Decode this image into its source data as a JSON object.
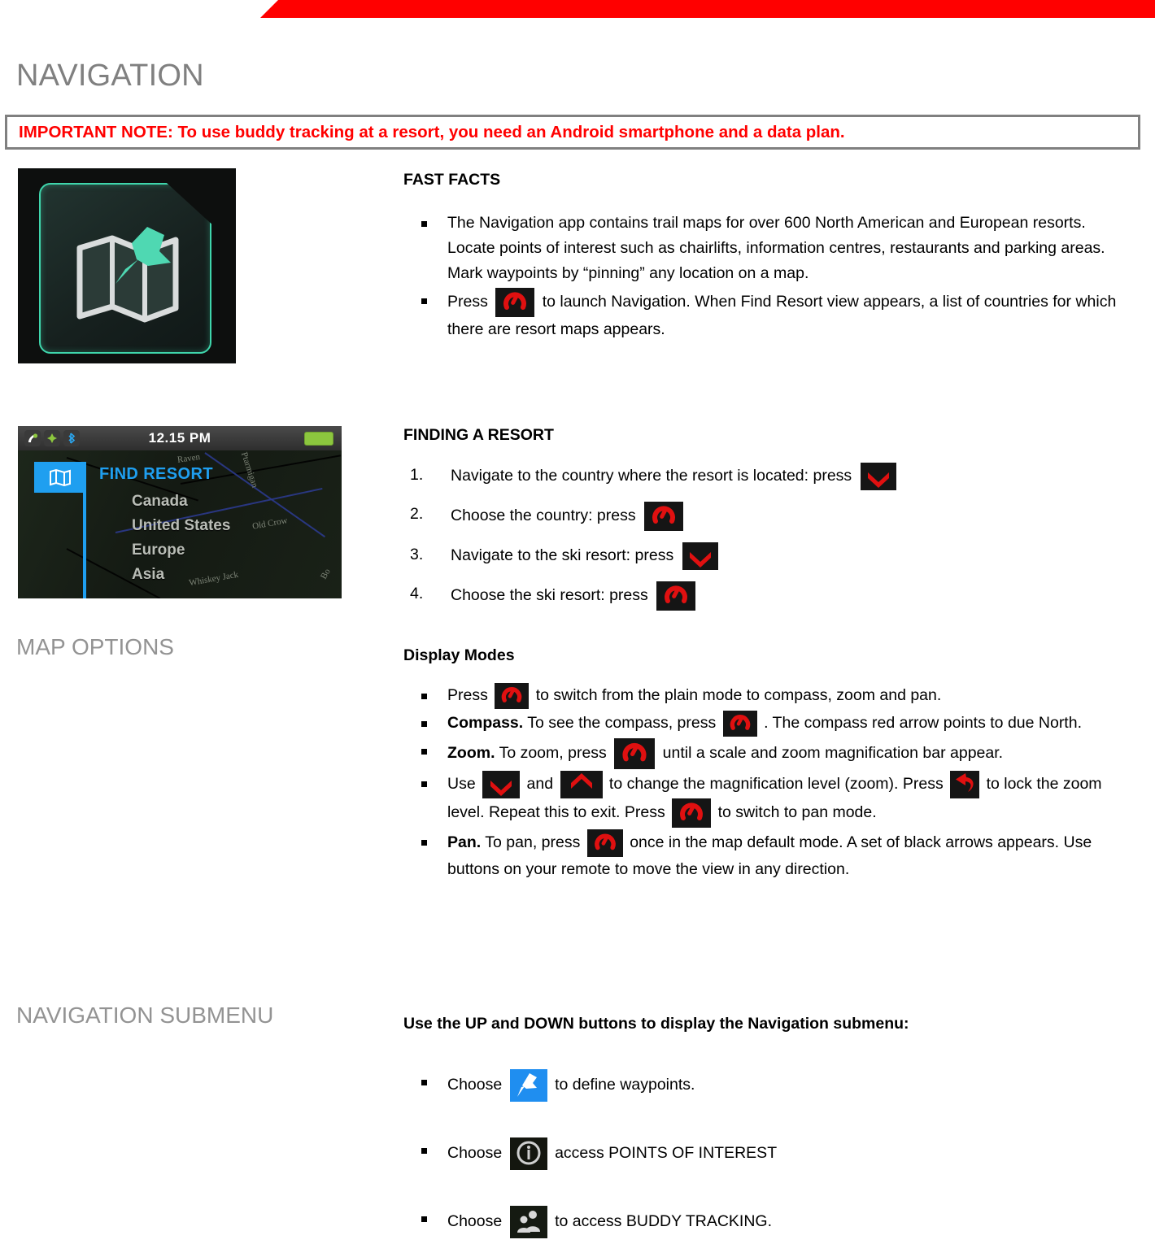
{
  "meta": {
    "accent_red": "#ff0000",
    "heading_gray": "#939393",
    "note_border_gray": "#808080",
    "device_blue": "#1f9ff0",
    "icon_teal": "#3fd6ac"
  },
  "banner": {
    "name": "top-red-banner"
  },
  "page_title": "NAVIGATION",
  "important_note": "IMPORTANT NOTE: To use buddy tracking at a resort, you need an Android smartphone and a data plan.",
  "app_icon": {
    "name": "navigation-app-icon",
    "label": "Navigation app icon: folded map with pushpin"
  },
  "device_screenshot": {
    "name": "find-resort-screenshot",
    "status_bar": {
      "icons": [
        "phone-signal-icon",
        "gps-nav-icon",
        "bluetooth-icon"
      ],
      "time": "12.15 PM",
      "battery": "battery-icon"
    },
    "selected_tab_icon": "map-icon",
    "title": "FIND RESORT",
    "countries": [
      "Canada",
      "United States",
      "Europe",
      "Asia"
    ],
    "map_labels": [
      "Raven",
      "Ptarmigan",
      "Old Crow",
      "Whiskey Jack",
      "Bo"
    ]
  },
  "fast_facts": {
    "heading": "FAST FACTS",
    "bullets": [
      {
        "text": "The Navigation app contains trail maps for over 600 North American and European resorts. Locate points of interest such as chairlifts, information centres, restaurants and parking areas. Mark waypoints by “pinning” any location on a map."
      },
      {
        "pre": "Press",
        "icon": "select-button-icon",
        "post": "to launch Navigation. When Find Resort view appears, a list of countries for which there are resort maps appears."
      }
    ]
  },
  "finding_resort": {
    "heading": "FINDING A RESORT",
    "steps": [
      {
        "num": "1.",
        "pre": "Navigate to the country where the resort is located: press",
        "icon": "down-button-icon",
        "post": ""
      },
      {
        "num": "2.",
        "pre": "Choose the country: press",
        "icon": "select-button-icon",
        "post": ""
      },
      {
        "num": "3.",
        "pre": "Navigate to the ski resort: press",
        "icon": "down-button-icon",
        "post": ""
      },
      {
        "num": "4.",
        "pre": "Choose the ski resort: press",
        "icon": "select-button-icon",
        "post": ""
      }
    ]
  },
  "map_options": {
    "heading": "MAP OPTIONS",
    "sub_heading": "Display Modes",
    "bullets": [
      {
        "lead": "",
        "pre": "Press",
        "icon1": "select-button-icon",
        "mid": "to switch from the plain mode to compass, zoom and pan.",
        "icon2": "",
        "post": ""
      },
      {
        "lead": "Compass.",
        "pre": "To see the compass, press",
        "icon1": "select-button-icon",
        "mid": ". The compass red arrow points to due North.",
        "icon2": "",
        "post": ""
      },
      {
        "lead": "Zoom.",
        "pre": "To zoom, press",
        "icon1": "select-button-icon",
        "mid": "until a scale and zoom magnification bar appear.",
        "icon2": "",
        "post": ""
      },
      {
        "lead": "",
        "pre": "Use",
        "icon1": "down-button-icon",
        "mid": "and",
        "icon2": "up-button-icon",
        "mid2": "to change the magnification level (zoom). Press",
        "icon3": "back-button-icon",
        "mid3": "to lock the zoom level. Repeat this to exit. Press",
        "icon4": "select-button-icon",
        "post": "to switch to pan mode."
      },
      {
        "lead": "Pan.",
        "pre": "To pan, press",
        "icon1": "select-button-icon",
        "mid": "once in the map default mode. A set of black arrows appears. Use buttons on your remote to move the view in any direction.",
        "icon2": "",
        "post": ""
      }
    ]
  },
  "nav_submenu": {
    "heading": "NAVIGATION SUBMENU",
    "intro": "Use the UP and DOWN buttons to display the Navigation submenu:",
    "bullets": [
      {
        "pre": "Choose",
        "icon": "waypoint-pin-icon",
        "post": "to define waypoints."
      },
      {
        "pre": "Choose",
        "icon": "points-of-interest-icon",
        "post": "access POINTS OF INTEREST"
      },
      {
        "pre": "Choose",
        "icon": "buddy-tracking-icon",
        "post": "to access BUDDY TRACKING."
      }
    ]
  }
}
